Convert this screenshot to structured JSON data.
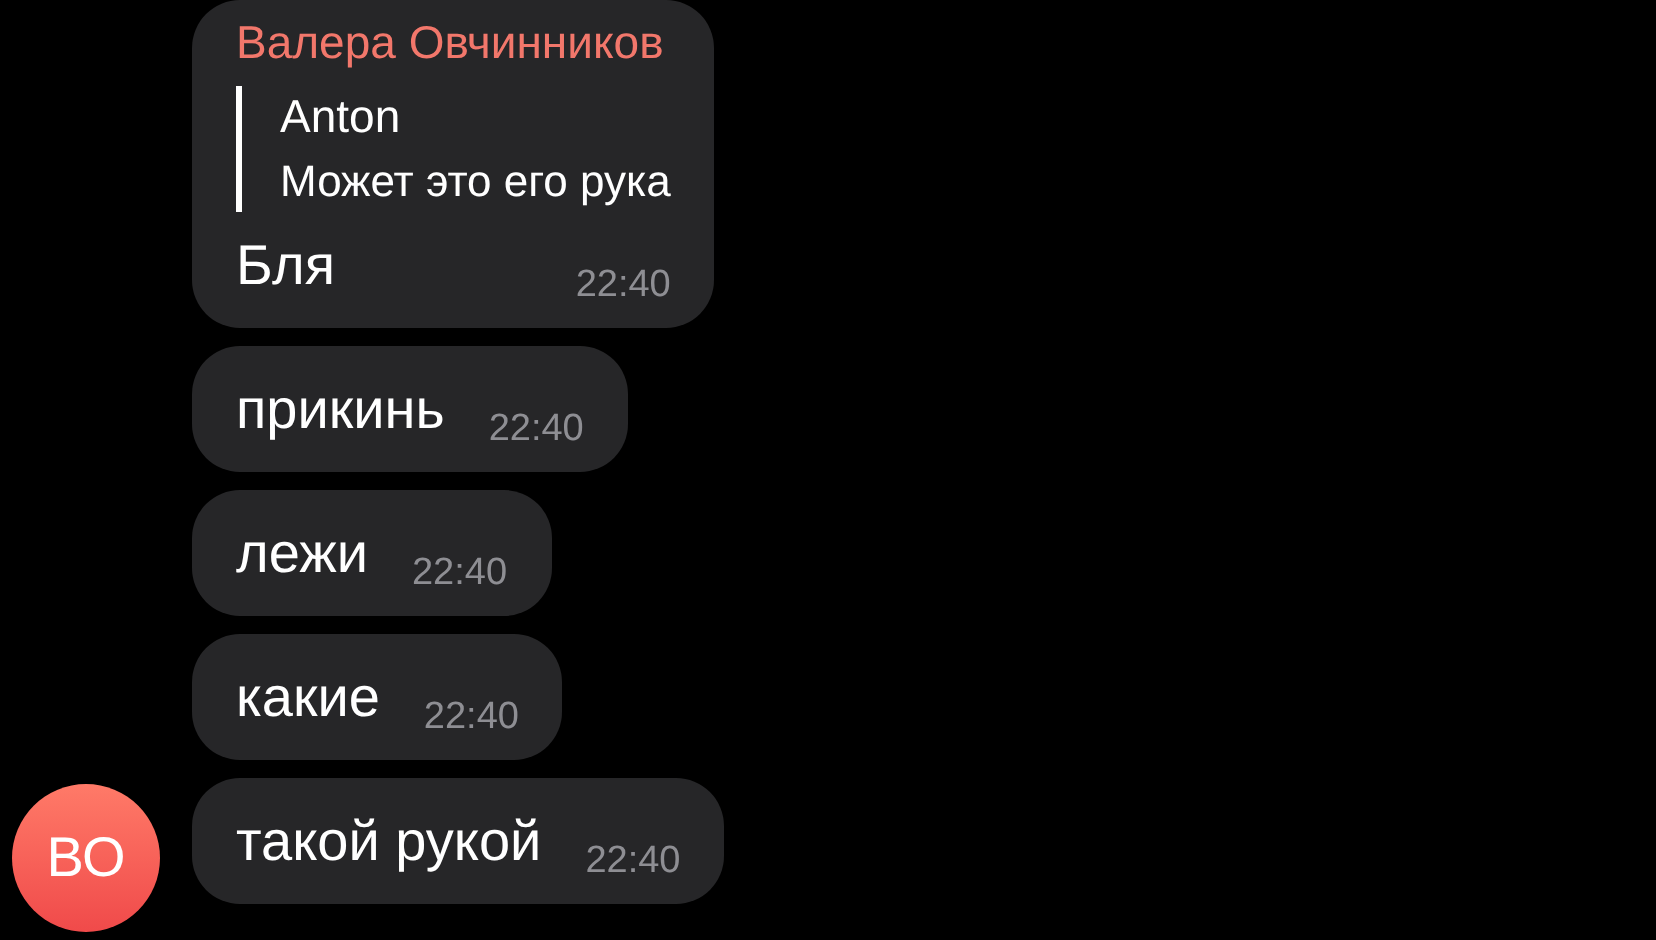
{
  "messages": [
    {
      "sender": "Валера Овчинников",
      "reply": {
        "author": "Anton",
        "text": "Может это его рука"
      },
      "text": "Бля",
      "time": "22:40"
    },
    {
      "text": "прикинь",
      "time": "22:40"
    },
    {
      "text": "лежи",
      "time": "22:40"
    },
    {
      "text": "какие",
      "time": "22:40"
    },
    {
      "text": "такой рукой",
      "time": "22:40",
      "avatar": "ВО"
    }
  ]
}
